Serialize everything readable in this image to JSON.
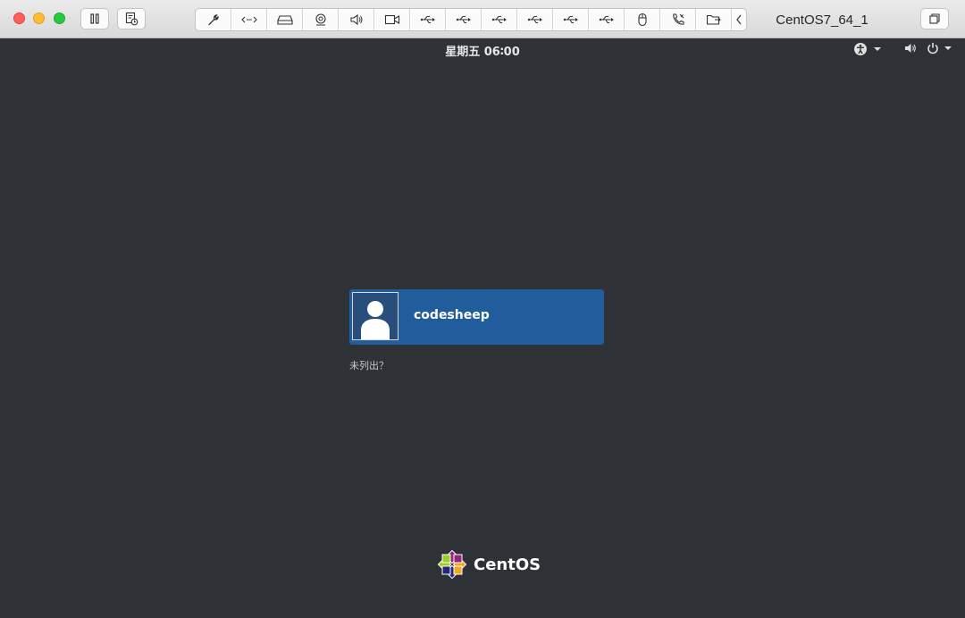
{
  "window": {
    "title": "CentOS7_64_1",
    "buttons": {
      "close": "close",
      "minimize": "minimize",
      "zoom": "zoom",
      "pause": "pause-icon",
      "snapshot": "snapshot-icon",
      "restore": "window-restore-icon"
    },
    "toolbar_icons": [
      "wrench-icon",
      "code-arrows-icon",
      "hard-drive-icon",
      "camera-icon",
      "speaker-icon",
      "video-camera-icon",
      "usb-icon",
      "usb-icon",
      "usb-icon",
      "usb-icon",
      "usb-icon",
      "usb-icon",
      "mouse-icon",
      "phone-icon",
      "shared-folder-icon",
      "chevron-left-icon"
    ]
  },
  "gdm": {
    "clock": "星期五 06∶00",
    "top_right_icons": [
      "accessibility-icon",
      "caret-down-icon",
      "volume-icon",
      "power-icon",
      "caret-down-icon"
    ],
    "user": {
      "name": "codesheep",
      "avatar_icon": "user-silhouette-icon"
    },
    "not_listed": "未列出？",
    "logo_text": "CentOS"
  },
  "colors": {
    "desktop_bg": "#2e3236",
    "user_tile_bg": "#215d9c",
    "titlebar_bg": "#e3e3e3"
  }
}
